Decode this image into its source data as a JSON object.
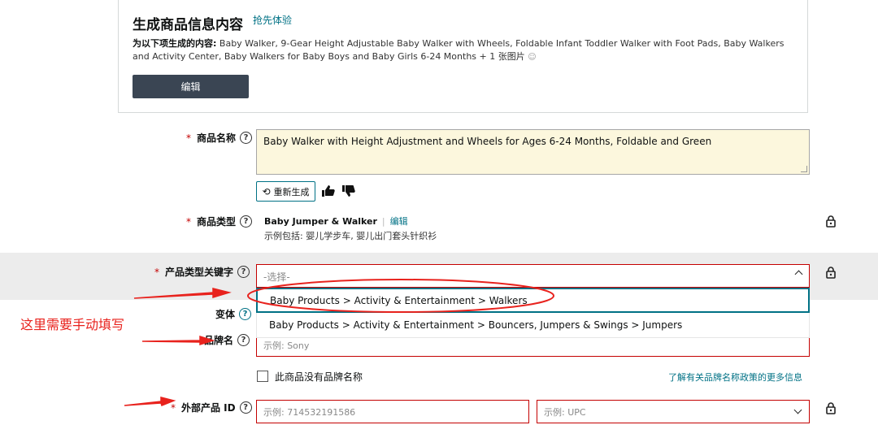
{
  "gen": {
    "title": "生成商品信息内容",
    "tag": "抢先体验",
    "desc_label": "为以下项生成的内容:",
    "desc_text": "Baby Walker, 9-Gear Height Adjustable Baby Walker with Wheels, Foldable Infant Toddler Walker with Foot Pads, Baby Walkers and Activity Center, Baby Walkers for Baby Boys and Baby Girls 6-24 Months + 1 张图片",
    "edit_label": "编辑"
  },
  "fields": {
    "title_label": "商品名称",
    "title_value": "Baby Walker with Height Adjustment and Wheels for Ages 6-24 Months, Foldable and Green",
    "regen_label": "重新生成",
    "ptype_label": "商品类型",
    "ptype_value": "Baby Jumper & Walker",
    "ptype_edit": "编辑",
    "ptype_example": "示例包括: 婴儿学步车, 婴儿出门套头针织衫",
    "kw_label": "产品类型关键字",
    "kw_placeholder": "-选择-",
    "kw_options": [
      "Baby Products > Activity & Entertainment > Walkers",
      "Baby Products > Activity & Entertainment > Bouncers, Jumpers & Swings > Jumpers"
    ],
    "variant_label": "变体",
    "brand_label": "品牌名",
    "brand_placeholder": "示例:  Sony",
    "no_brand_label": "此商品没有品牌名称",
    "brand_policy_link": "了解有关品牌名称政策的更多信息",
    "extid_label": "外部产品 ID",
    "extid_placeholder": "示例:  714532191586",
    "extid_type_placeholder": "示例:  UPC"
  },
  "annotation": {
    "note": "这里需要手动填写"
  },
  "colors": {
    "required": "#c40000",
    "link": "#007185",
    "annotation": "#e8221d",
    "button_dark": "#3a4553"
  }
}
